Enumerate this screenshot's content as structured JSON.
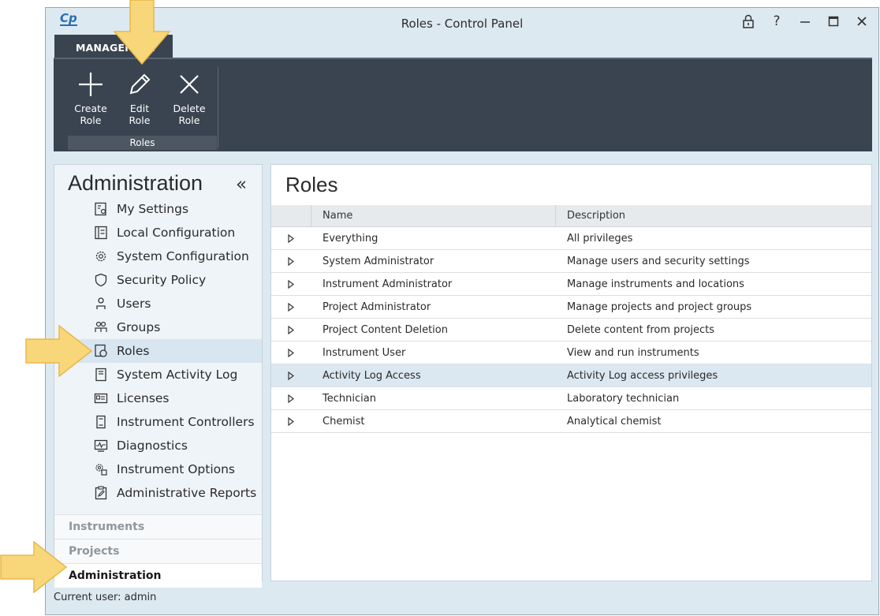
{
  "window": {
    "logo_text": "Cp",
    "title": "Roles - Control Panel",
    "controls": {
      "lock": "lock-icon",
      "help": "?",
      "minimize": "minimize-icon",
      "maximize": "maximize-icon",
      "close": "close-icon"
    }
  },
  "ribbon": {
    "tab_label": "MANAGEMENT",
    "buttons": [
      {
        "label": "Create\nRole",
        "icon": "plus-icon"
      },
      {
        "label": "Edit\nRole",
        "icon": "pencil-icon"
      },
      {
        "label": "Delete\nRole",
        "icon": "x-icon"
      }
    ],
    "group_label": "Roles"
  },
  "nav": {
    "title": "Administration",
    "collapse_glyph": "«",
    "items": [
      {
        "label": "My Settings",
        "icon": "my-settings-icon"
      },
      {
        "label": "Local Configuration",
        "icon": "local-configuration-icon"
      },
      {
        "label": "System Configuration",
        "icon": "gear-icon"
      },
      {
        "label": "Security Policy",
        "icon": "shield-icon"
      },
      {
        "label": "Users",
        "icon": "user-icon"
      },
      {
        "label": "Groups",
        "icon": "group-icon"
      },
      {
        "label": "Roles",
        "icon": "roles-icon",
        "active": true
      },
      {
        "label": "System Activity Log",
        "icon": "log-icon"
      },
      {
        "label": "Licenses",
        "icon": "license-icon"
      },
      {
        "label": "Instrument Controllers",
        "icon": "controller-icon"
      },
      {
        "label": "Diagnostics",
        "icon": "diagnostics-icon"
      },
      {
        "label": "Instrument Options",
        "icon": "options-icon"
      },
      {
        "label": "Administrative Reports",
        "icon": "report-icon"
      }
    ],
    "sections": [
      {
        "label": "Instruments"
      },
      {
        "label": "Projects"
      },
      {
        "label": "Administration",
        "current": true
      }
    ]
  },
  "main": {
    "title": "Roles",
    "columns": {
      "name": "Name",
      "description": "Description"
    },
    "rows": [
      {
        "name": "Everything",
        "description": "All privileges"
      },
      {
        "name": "System Administrator",
        "description": "Manage users and security settings"
      },
      {
        "name": "Instrument Administrator",
        "description": "Manage instruments and locations"
      },
      {
        "name": "Project Administrator",
        "description": "Manage projects and project groups"
      },
      {
        "name": "Project Content Deletion",
        "description": "Delete content from projects"
      },
      {
        "name": "Instrument User",
        "description": "View and run instruments"
      },
      {
        "name": "Activity Log Access",
        "description": "Activity Log access privileges",
        "selected": true
      },
      {
        "name": "Technician",
        "description": "Laboratory technician"
      },
      {
        "name": "Chemist",
        "description": "Analytical chemist"
      }
    ]
  },
  "status": {
    "current_user": "Current user: admin"
  },
  "colors": {
    "ribbon": "#394450",
    "window": "#dde9f1",
    "selection": "#dbe8f2",
    "callout": "#f8d77a"
  }
}
